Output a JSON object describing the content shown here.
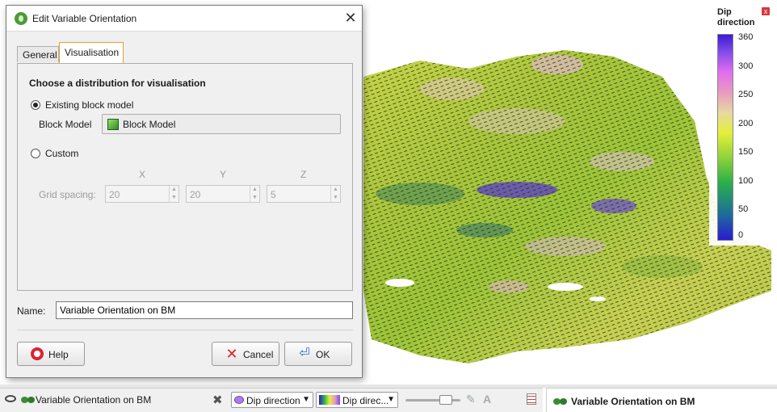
{
  "dialog": {
    "title": "Edit Variable Orientation",
    "tabs": [
      {
        "label": "General",
        "active": false
      },
      {
        "label": "Visualisation",
        "active": true
      }
    ],
    "visualisation": {
      "heading": "Choose a distribution for visualisation",
      "option_existing": "Existing block model",
      "block_model_label": "Block Model",
      "block_model_value": "Block Model",
      "option_custom": "Custom",
      "axes": [
        "X",
        "Y",
        "Z"
      ],
      "grid_spacing_label": "Grid spacing:",
      "grid_spacing_values": [
        "20",
        "20",
        "5"
      ],
      "selected": "existing"
    },
    "name_label": "Name:",
    "name_value": "Variable Orientation on BM",
    "buttons": {
      "help": "Help",
      "cancel": "Cancel",
      "ok": "OK"
    }
  },
  "legend": {
    "title": "Dip direction",
    "ticks": [
      "360",
      "300",
      "250",
      "200",
      "150",
      "100",
      "50",
      "0"
    ],
    "colors": [
      "#3a1bd6",
      "#7e4ae8",
      "#e06cf0",
      "#e79bc0",
      "#e6d9a0",
      "#e3ef3a",
      "#8fd23a",
      "#2bb04a",
      "#1e6a9e",
      "#2a1ad0"
    ]
  },
  "bottom_bar": {
    "layer_name": "Variable Orientation on BM",
    "attribute": "Dip direction",
    "colormap": "Dip direc...",
    "right_panel_title": "Variable Orientation on BM"
  },
  "icons": {
    "app": "leapfrog-logo-icon",
    "close": "close-icon",
    "visibility": "eye-icon",
    "remove": "x-icon"
  }
}
